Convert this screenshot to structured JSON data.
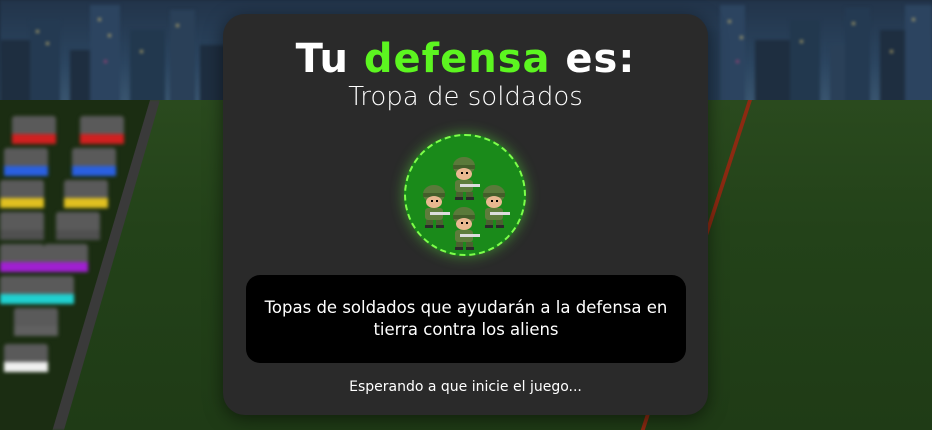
{
  "defense_card": {
    "title_prefix": "Tu ",
    "title_highlight": "defensa",
    "title_suffix": " es:",
    "defense_name": "Tropa de soldados",
    "defense_icon": "soldier-troop-icon",
    "description": "Topas de soldados que ayudarán a la defensa en tierra contra los aliens",
    "status": "Esperando a que inicie el juego..."
  },
  "colors": {
    "highlight": "#5cf520",
    "panel": "#2a2a2a",
    "badge_fill": "#1a8a1a",
    "badge_ring": "#7cff4a",
    "field": "#234219",
    "field_line": "#8c2a12"
  }
}
